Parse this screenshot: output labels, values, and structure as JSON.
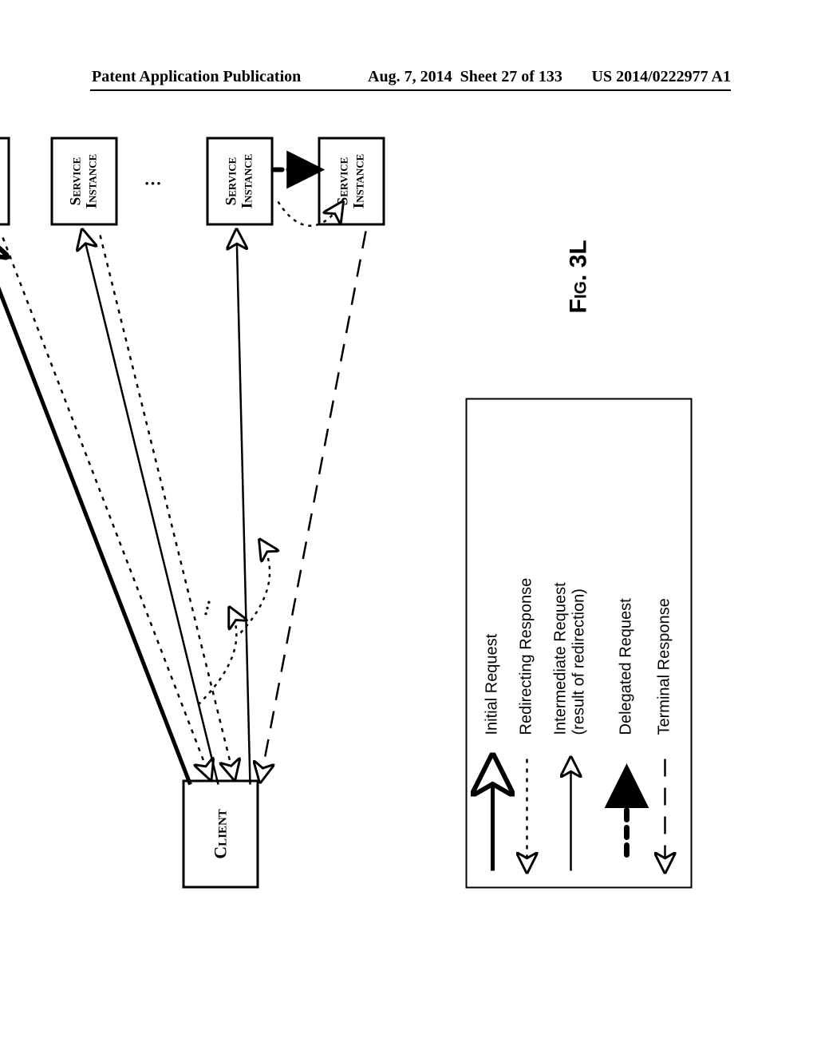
{
  "header": {
    "left": "Patent Application Publication",
    "mid_date": "Aug. 7, 2014",
    "mid_sheet": "Sheet 27 of 133",
    "right": "US 2014/0222977 A1"
  },
  "figure_label": "Fig. 3L",
  "nodes": {
    "client": "Client",
    "service_instance": "Service Instance"
  },
  "legend": {
    "items": [
      "Initial Request",
      "Redirecting Response",
      "Intermediate Request (result of redirection)",
      "Delegated Request",
      "Terminal Response"
    ]
  }
}
